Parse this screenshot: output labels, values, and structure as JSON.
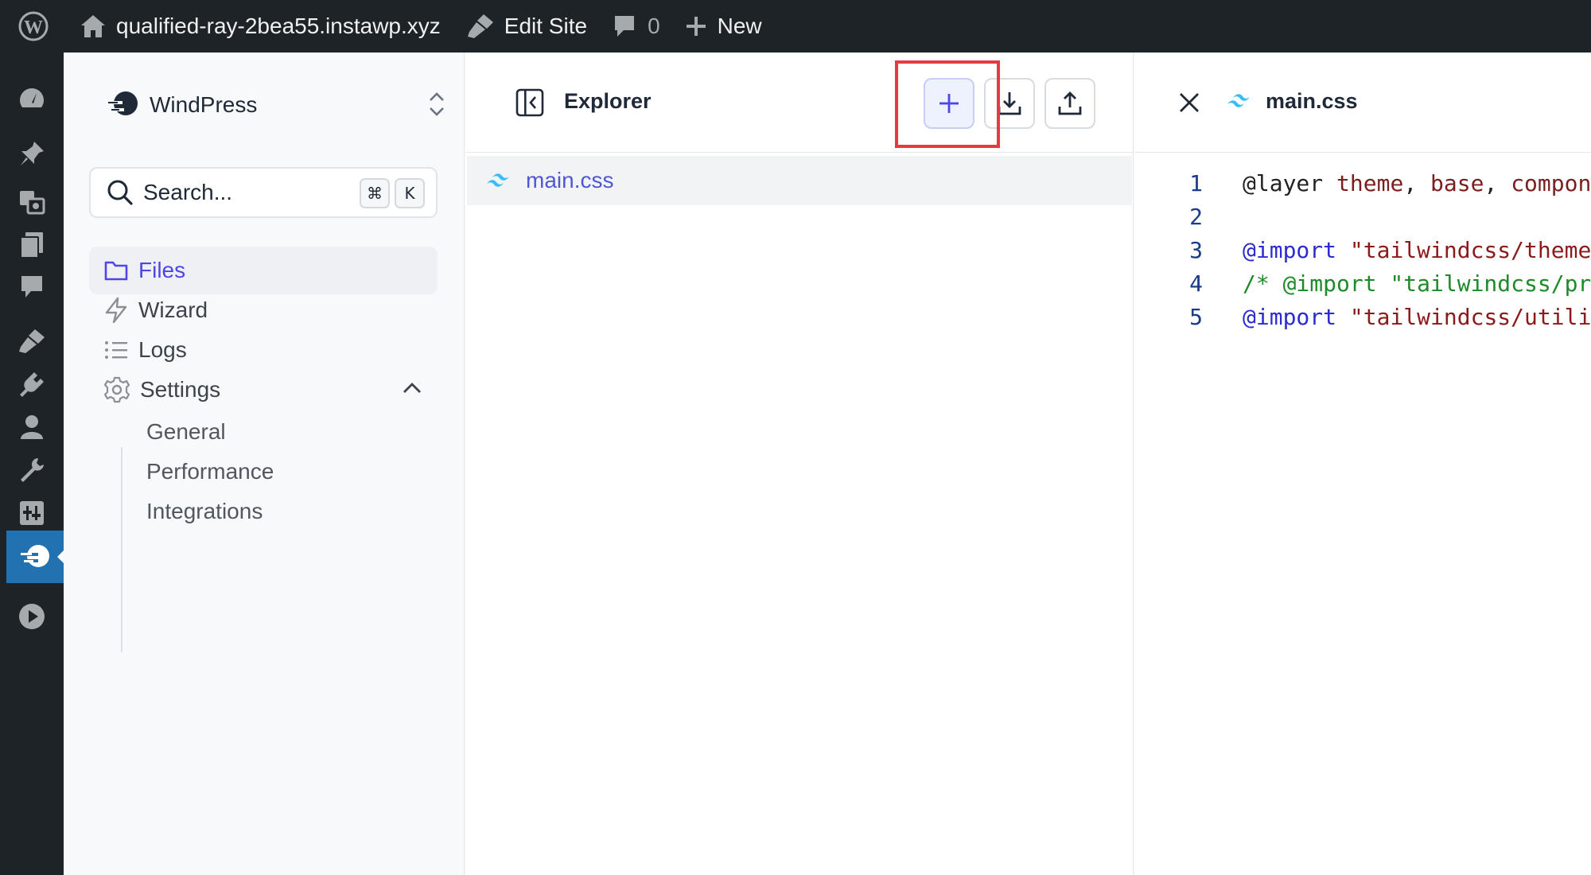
{
  "admin_bar": {
    "site_name": "qualified-ray-2bea55.instawp.xyz",
    "edit_site": "Edit Site",
    "comments_count": "0",
    "new_label": "New"
  },
  "admin_menu": {
    "icons": [
      "dashboard-icon",
      "pin-icon",
      "media-icon",
      "pages-icon",
      "comments-icon",
      "appearance-icon",
      "plugins-icon",
      "users-icon",
      "tools-icon",
      "settings-icon",
      "windpress-icon",
      "play-icon"
    ],
    "current": "windpress-icon"
  },
  "nav": {
    "brand": "WindPress",
    "search_placeholder": "Search...",
    "shortcut_mod": "⌘",
    "shortcut_key": "K",
    "items": [
      {
        "label": "Files",
        "active": true
      },
      {
        "label": "Wizard"
      },
      {
        "label": "Logs"
      },
      {
        "label": "Settings",
        "expanded": true
      }
    ],
    "settings_sub": [
      "General",
      "Performance",
      "Integrations"
    ]
  },
  "explorer": {
    "title": "Explorer",
    "files": [
      {
        "name": "main.css"
      }
    ]
  },
  "editor": {
    "tab": "main.css",
    "lines": [
      {
        "n": "1",
        "text": "@layer theme, base, components, utilities;"
      },
      {
        "n": "2",
        "text": ""
      },
      {
        "n": "3",
        "text": "@import \"tailwindcss/theme.css\" layer(theme);"
      },
      {
        "n": "4",
        "text": "/* @import \"tailwindcss/preflight.css\" layer(base); */"
      },
      {
        "n": "5",
        "text": "@import \"tailwindcss/utilities.css\" layer(utilities);"
      }
    ]
  },
  "colors": {
    "accent": "#4f46e5",
    "wp_bar": "#1d2327",
    "wp_current": "#2271b1",
    "highlight": "#e53945",
    "tailwind": "#38bdf8"
  }
}
